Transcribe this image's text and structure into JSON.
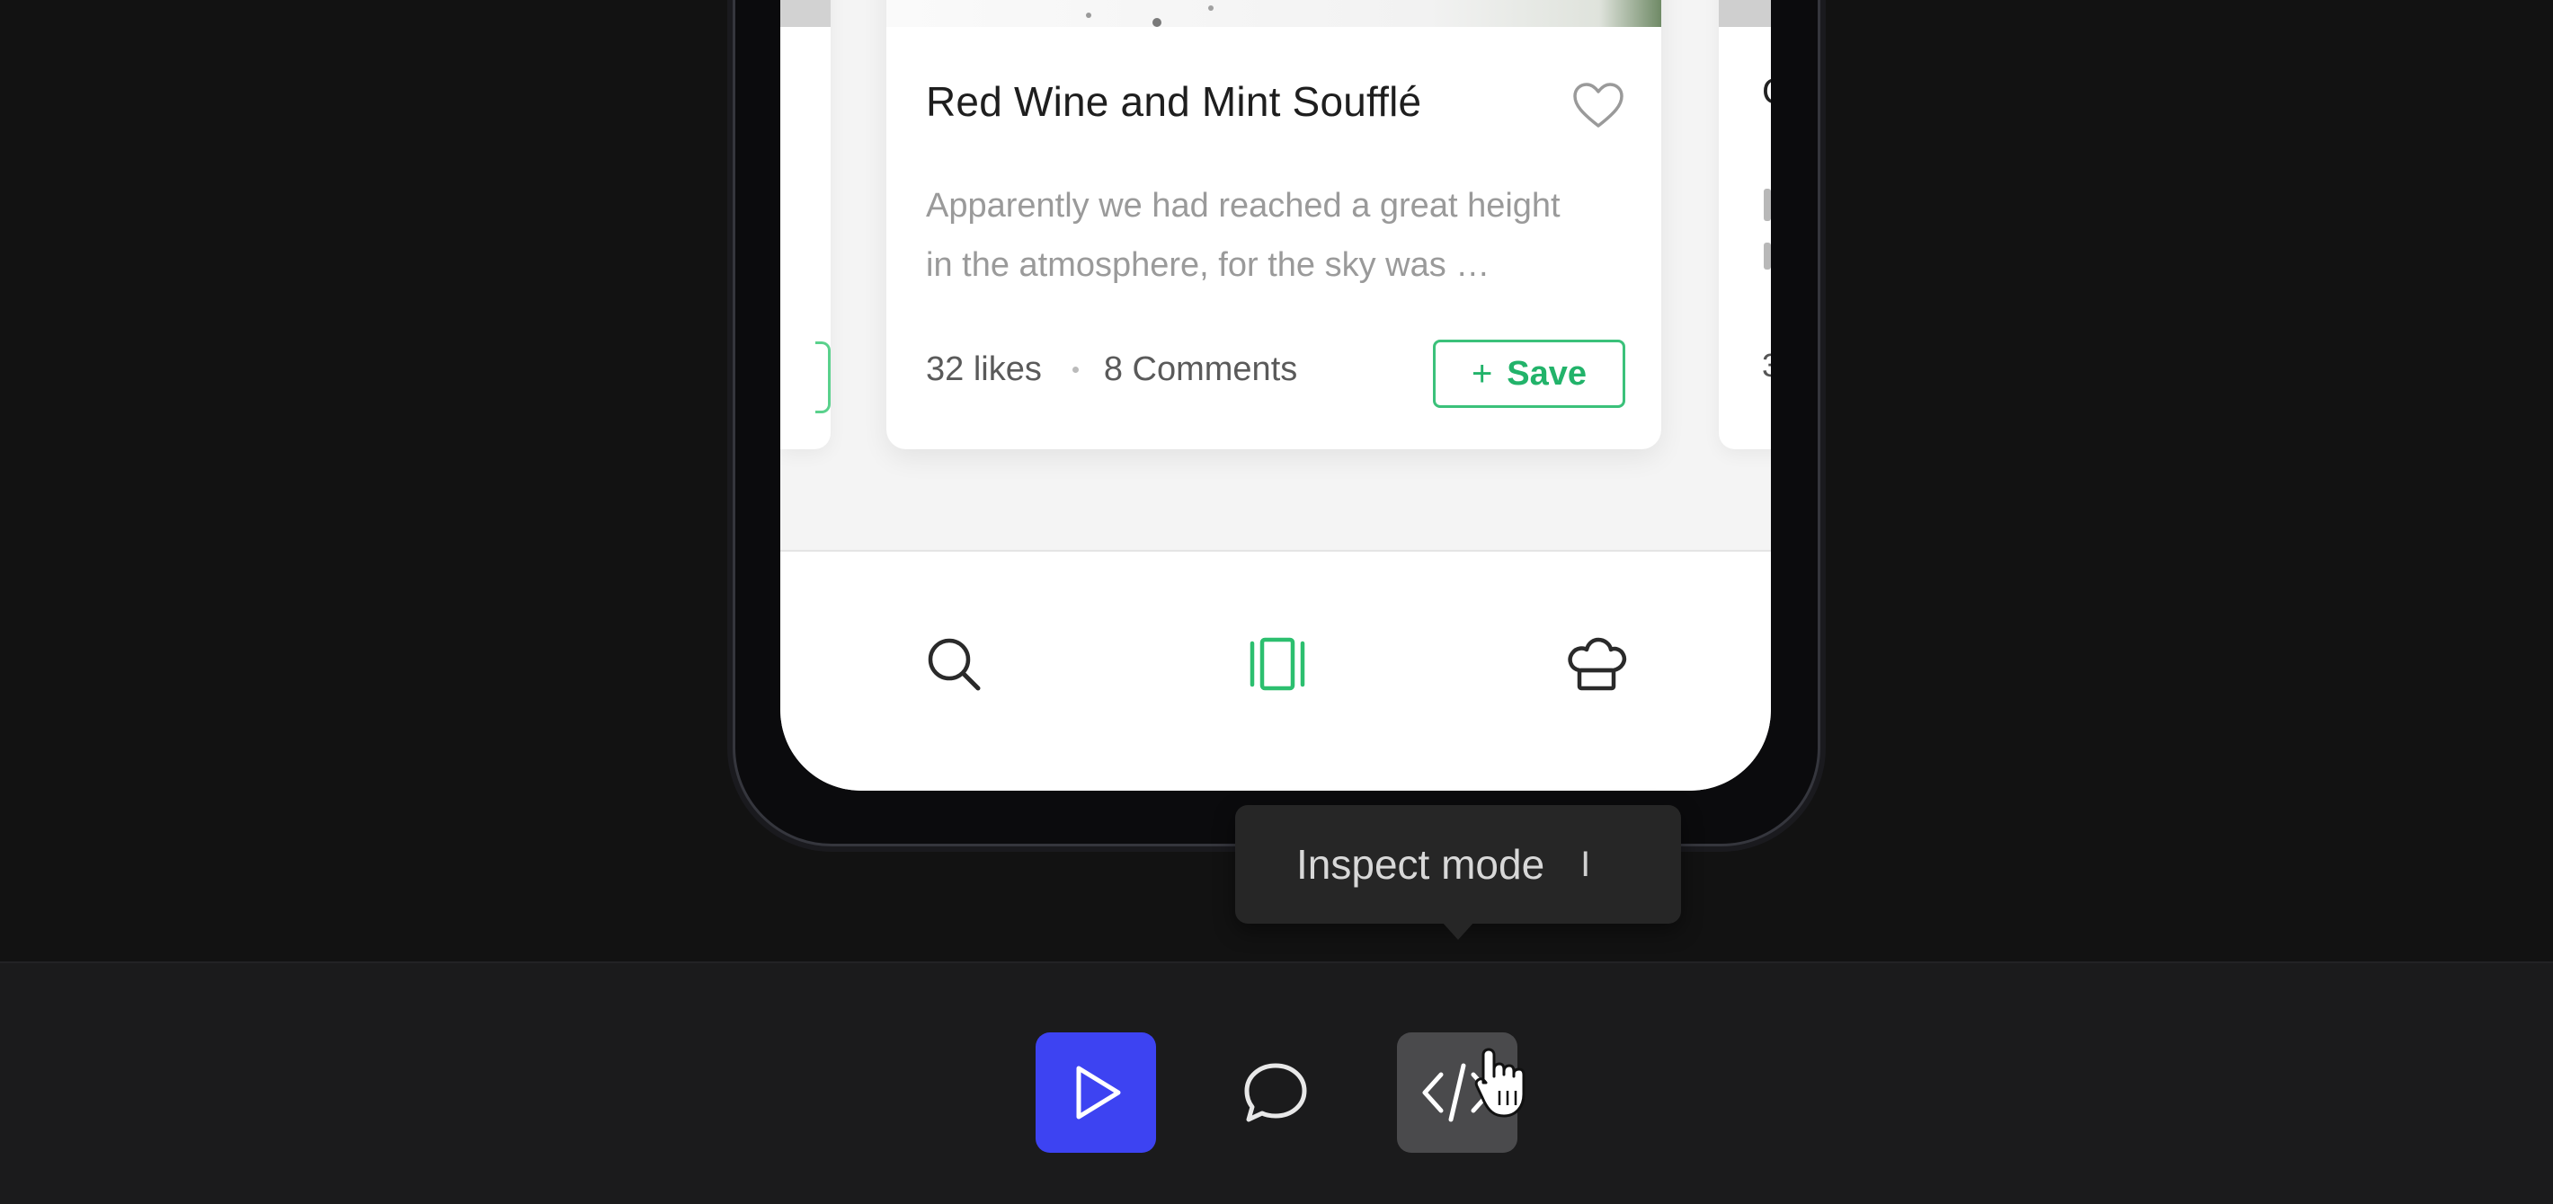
{
  "card": {
    "title": "Red Wine and Mint Soufflé",
    "description_line1": "Apparently we had reached a great height",
    "description_line2": "in the atmosphere, for the sky was …",
    "likes": "32 likes",
    "comments": "8 Comments",
    "save_label": "Save",
    "save_plus": "+"
  },
  "side_card_right": {
    "title_peek": "C",
    "count_peek": "3"
  },
  "tab_bar": {
    "items": [
      {
        "icon": "search-icon",
        "active": false
      },
      {
        "icon": "cards-icon",
        "active": true
      },
      {
        "icon": "chef-hat-icon",
        "active": false
      }
    ],
    "active_color": "#2cbf6f",
    "inactive_color": "#2a2a2a"
  },
  "tooltip": {
    "label": "Inspect mode",
    "shortcut": "I"
  },
  "toolbar": {
    "buttons": [
      {
        "icon": "play-icon",
        "label": "Play",
        "color": "#3d43f2"
      },
      {
        "icon": "comment-icon",
        "label": "Comment"
      },
      {
        "icon": "code-icon",
        "label": "Inspect",
        "active": true
      }
    ]
  },
  "colors": {
    "accent_green": "#2cbf6f",
    "play_blue": "#3d43f2",
    "background": "#121212"
  }
}
